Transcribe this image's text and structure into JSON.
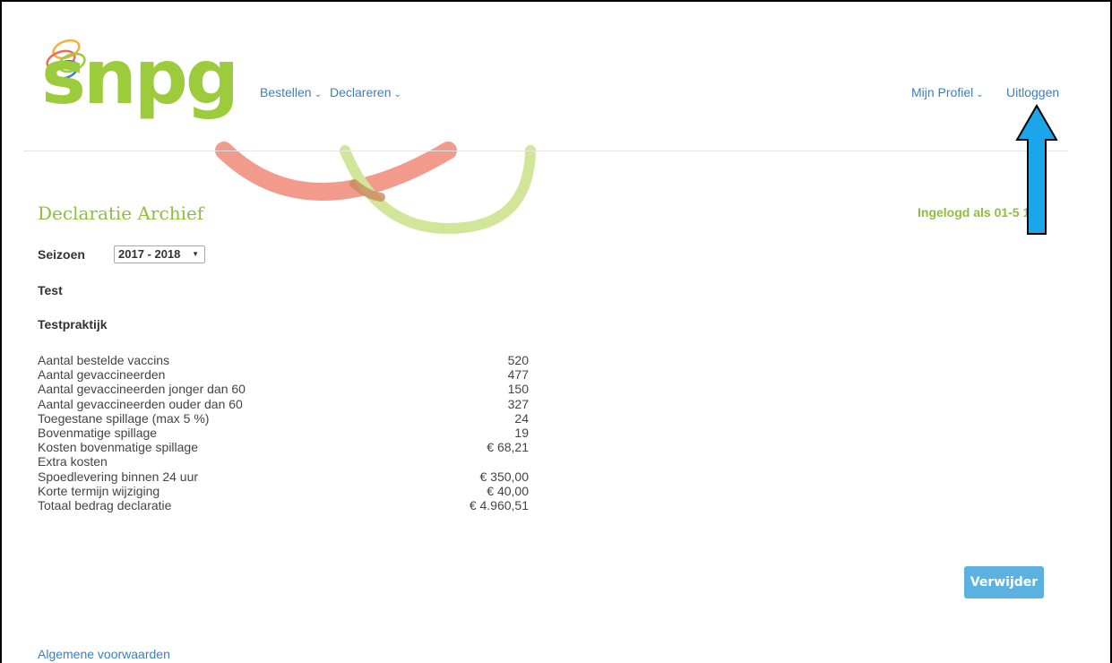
{
  "brand": {
    "logo_text": "snpg",
    "colors": {
      "green": "#9ccb3b",
      "link_blue": "#3a7fc1",
      "button_blue": "#5bb2e0",
      "deco_red": "#f29a8c",
      "deco_green": "#d2e69a",
      "arrow_blue": "#1aa6e8"
    }
  },
  "nav": {
    "items": [
      {
        "label": "Bestellen",
        "icon": "chevron-down-icon"
      },
      {
        "label": "Declareren",
        "icon": "chevron-down-icon"
      }
    ],
    "profile": {
      "label": "Mijn Profiel",
      "icon": "chevron-down-icon"
    },
    "logout": {
      "label": "Uitloggen"
    }
  },
  "page": {
    "title": "Declaratie Archief",
    "logged_in": "Ingelogd als 01-5     12"
  },
  "season": {
    "label": "Seizoen",
    "selected": "2017 - 2018"
  },
  "org_name": "Test",
  "practice_name": "Testpraktijk",
  "stats": [
    {
      "label": "Aantal bestelde vaccins",
      "value": "520"
    },
    {
      "label": "Aantal gevaccineerden",
      "value": "477"
    },
    {
      "label": "Aantal gevaccineerden jonger dan 60",
      "value": "150"
    },
    {
      "label": "Aantal gevaccineerden ouder dan 60",
      "value": "327"
    },
    {
      "label": "Toegestane spillage (max 5 %)",
      "value": "24"
    },
    {
      "label": "Bovenmatige spillage",
      "value": "19"
    },
    {
      "label": "Kosten bovenmatige spillage",
      "value": "€ 68,21"
    },
    {
      "label": "Extra kosten",
      "value": ""
    },
    {
      "label": "Spoedlevering binnen 24 uur",
      "value": "€ 350,00"
    },
    {
      "label": "Korte termijn wijziging",
      "value": "€ 40,00"
    },
    {
      "label": "Totaal bedrag declaratie",
      "value": "€ 4.960,51"
    }
  ],
  "actions": {
    "delete_label": "Verwijder"
  },
  "footer": {
    "terms_label": "Algemene voorwaarden"
  }
}
